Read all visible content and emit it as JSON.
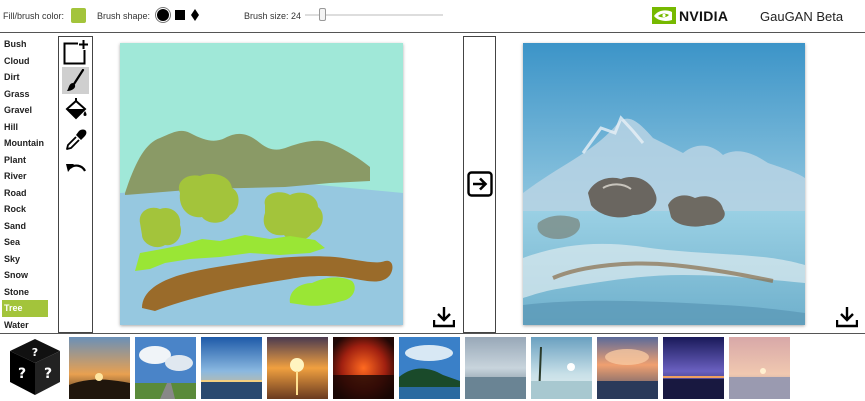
{
  "toolbar": {
    "fill_label": "Fill/brush color:",
    "fill_color": "#a3c43b",
    "shape_label": "Brush shape:",
    "shapes": [
      "circle",
      "square",
      "diamond"
    ],
    "size_label": "Brush size: 24",
    "brush_size": 24
  },
  "header": {
    "brand": "NVIDIA",
    "app_title": "GauGAN Beta"
  },
  "labels": {
    "items": [
      "Bush",
      "Cloud",
      "Dirt",
      "Grass",
      "Gravel",
      "Hill",
      "Mountain",
      "Plant",
      "River",
      "Road",
      "Rock",
      "Sand",
      "Sea",
      "Sky",
      "Snow",
      "Stone",
      "Tree",
      "Water"
    ],
    "active": "Tree"
  },
  "tools": [
    "new-canvas-icon",
    "brush-icon",
    "paint-bucket-icon",
    "eyedropper-icon",
    "undo-icon"
  ],
  "colors": {
    "sky": "#a0e8d8",
    "sea": "#96c8e0",
    "mountain": "#8a9a66",
    "tree": "#a3c43b",
    "grass": "#9ae635",
    "dirt": "#9a6b2a",
    "accent": "#a3c43b"
  },
  "gallery": {
    "count": 12
  }
}
